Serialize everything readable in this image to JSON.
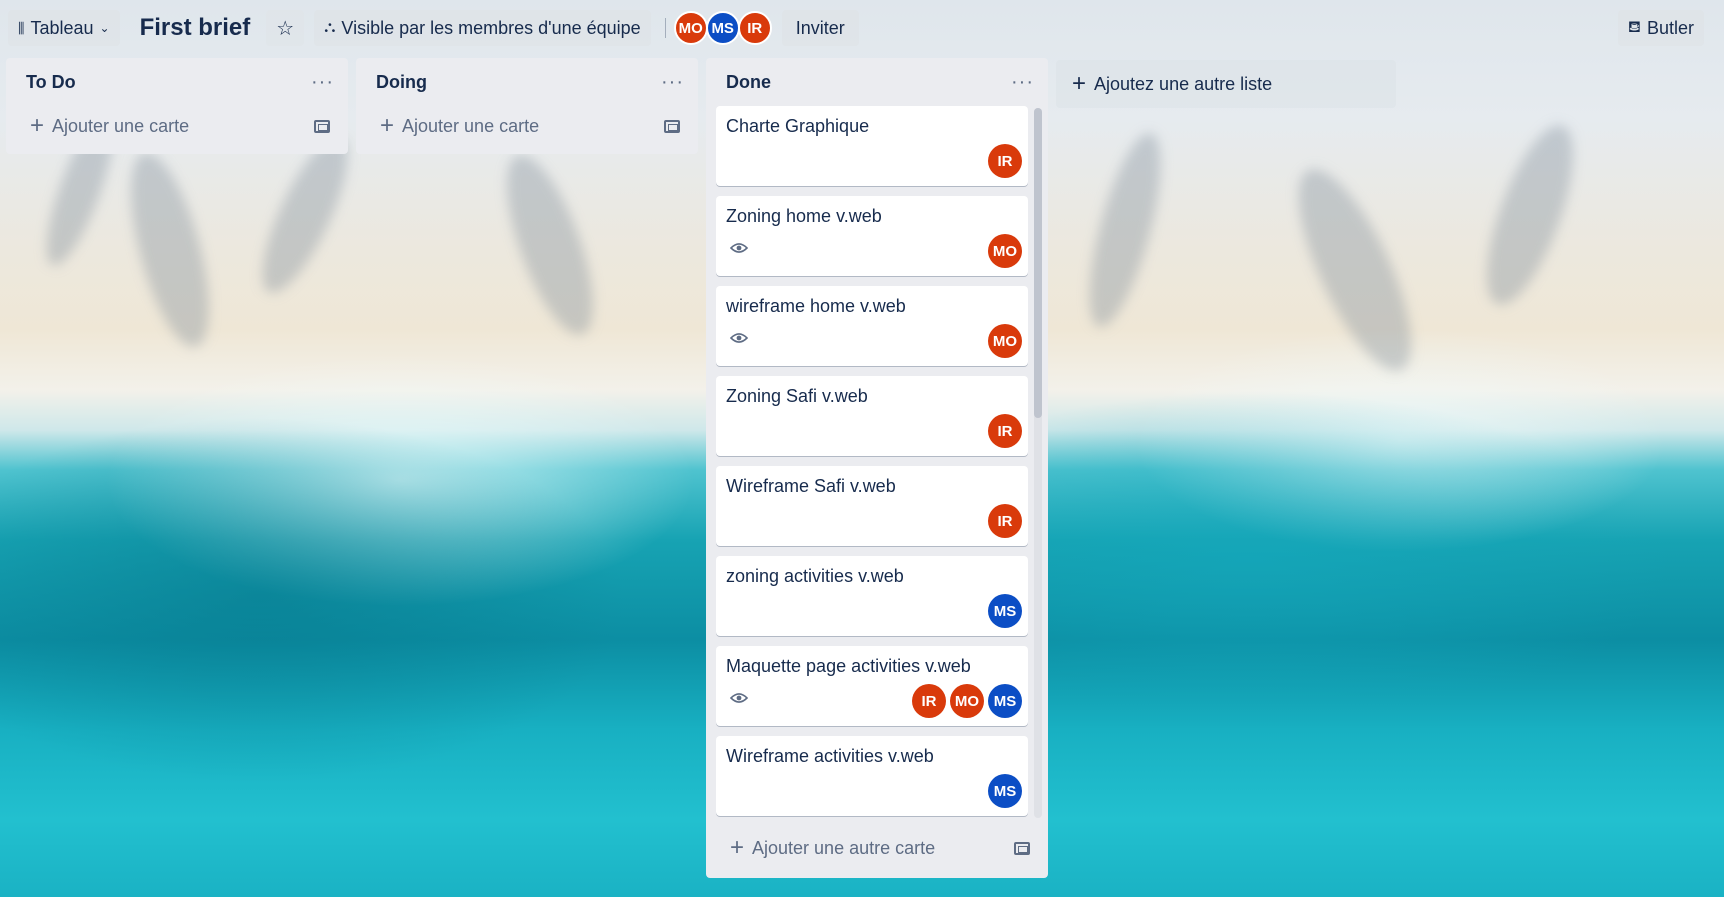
{
  "header": {
    "view_label": "Tableau",
    "board_title": "First brief",
    "visibility_label": "Visible par les membres d'une équipe",
    "members": [
      "MO",
      "MS",
      "IR"
    ],
    "invite_label": "Inviter",
    "butler_label": "Butler"
  },
  "lists": [
    {
      "title": "To Do",
      "add_card_label": "Ajouter une carte",
      "cards": []
    },
    {
      "title": "Doing",
      "add_card_label": "Ajouter une carte",
      "cards": []
    },
    {
      "title": "Done",
      "add_card_label": "Ajouter une autre carte",
      "cards": [
        {
          "title": "Charte Graphique",
          "watched": false,
          "members": [
            "IR"
          ]
        },
        {
          "title": "Zoning home v.web",
          "watched": true,
          "members": [
            "MO"
          ]
        },
        {
          "title": "wireframe home v.web",
          "watched": true,
          "members": [
            "MO"
          ]
        },
        {
          "title": "Zoning Safi v.web",
          "watched": false,
          "members": [
            "IR"
          ]
        },
        {
          "title": "Wireframe Safi v.web",
          "watched": false,
          "members": [
            "IR"
          ]
        },
        {
          "title": "zoning activities v.web",
          "watched": false,
          "members": [
            "MS"
          ]
        },
        {
          "title": "Maquette page activities v.web",
          "watched": true,
          "members": [
            "IR",
            "MO",
            "MS"
          ]
        },
        {
          "title": "Wireframe activities v.web",
          "watched": false,
          "members": [
            "MS"
          ]
        }
      ]
    }
  ],
  "add_list_label": "Ajoutez une autre liste",
  "colors": {
    "member_red": "#d93a0b",
    "member_blue": "#0c4ec5"
  }
}
